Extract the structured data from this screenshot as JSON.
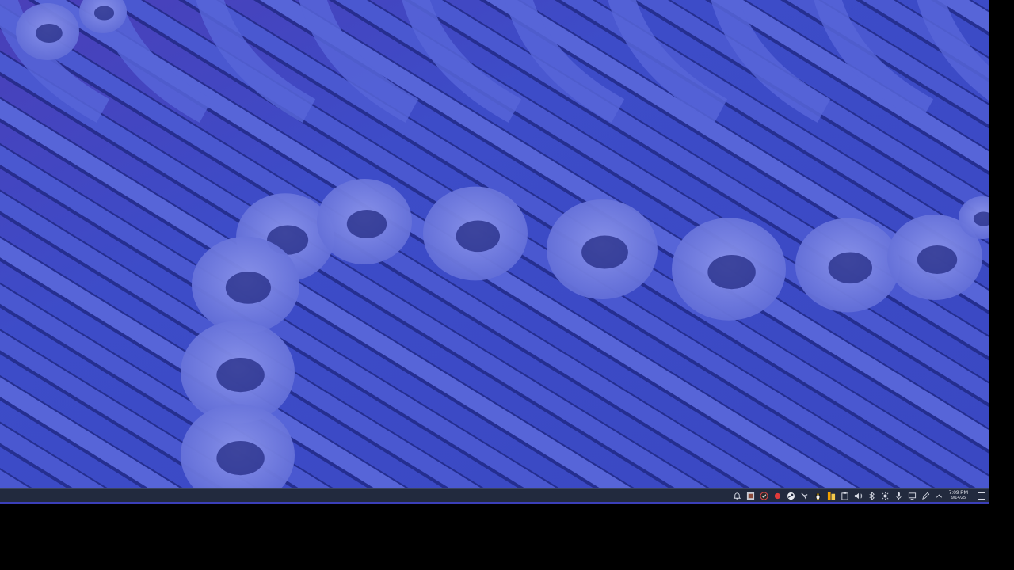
{
  "desktop": {
    "wallpaper": "blue-ribbons-wallpaper",
    "colors": {
      "base": "#3d4ac4",
      "ribbon": "#5765d8",
      "ribbon_light": "#7b86e6",
      "shadow": "#1e257e",
      "accent": "#7a3fb8"
    }
  },
  "taskbar": {
    "tray_icons": [
      "notification-bell-icon",
      "app-icon",
      "security-icon",
      "record-icon",
      "steam-icon",
      "network-tool-icon",
      "penguin-icon",
      "files-icon",
      "clipboard-icon",
      "volume-icon",
      "bluetooth-icon",
      "brightness-icon",
      "microphone-icon",
      "display-icon",
      "pen-icon",
      "chevron-up-icon"
    ],
    "clock": {
      "time": "7:09 PM",
      "date": "9/14/25"
    }
  }
}
